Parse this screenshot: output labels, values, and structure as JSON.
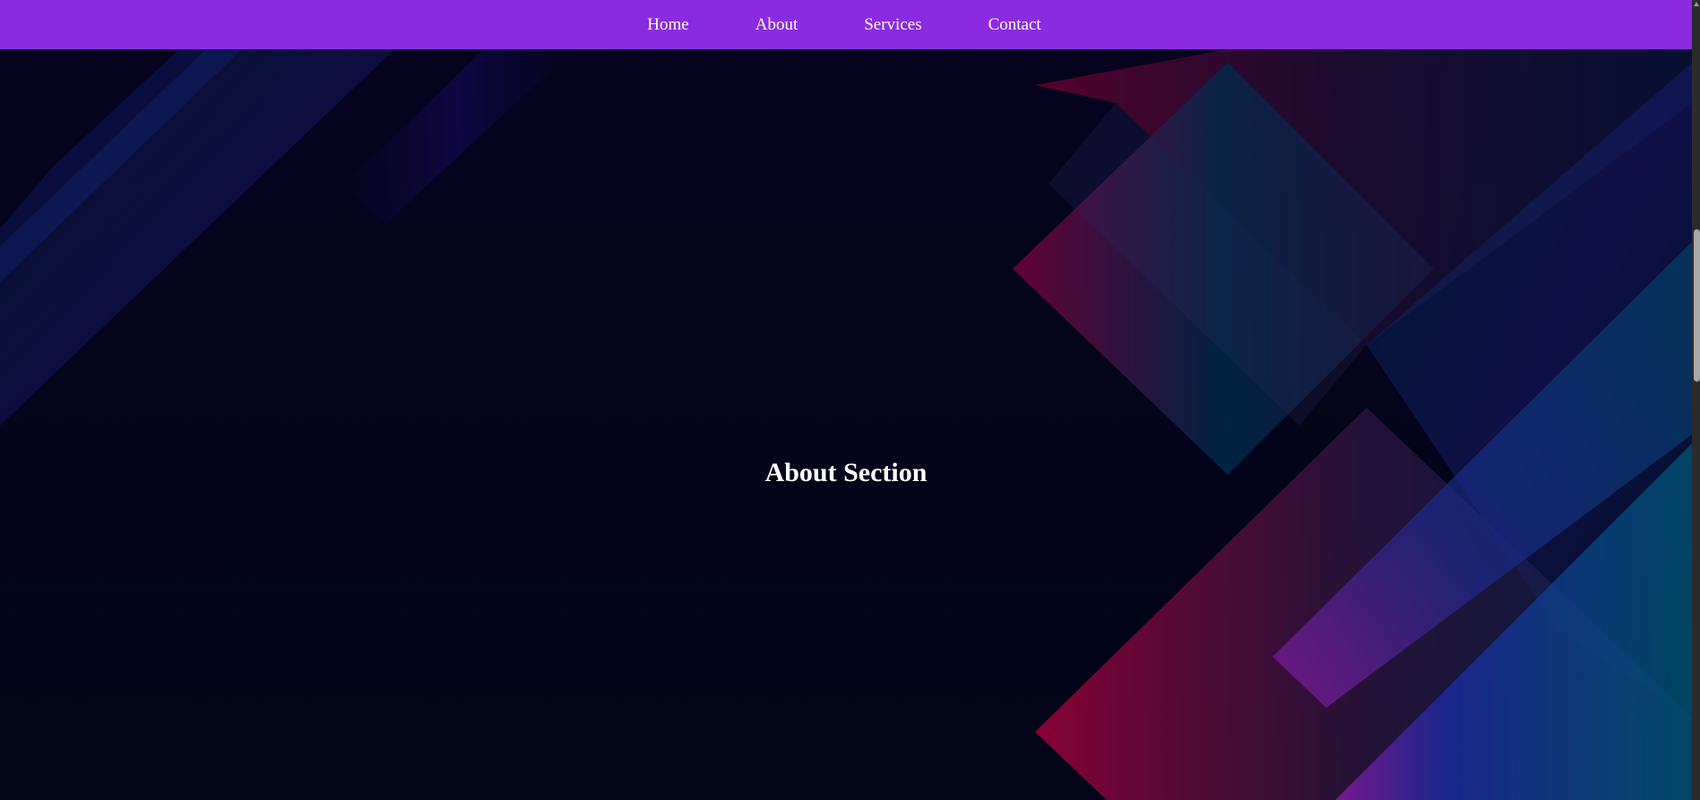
{
  "nav": {
    "items": [
      {
        "label": "Home"
      },
      {
        "label": "About"
      },
      {
        "label": "Services"
      },
      {
        "label": "Contact"
      }
    ]
  },
  "section": {
    "title": "About Section"
  },
  "colors": {
    "nav_background": "#8a2be2",
    "page_background": "#03041a",
    "title_text": "#ffffff"
  }
}
